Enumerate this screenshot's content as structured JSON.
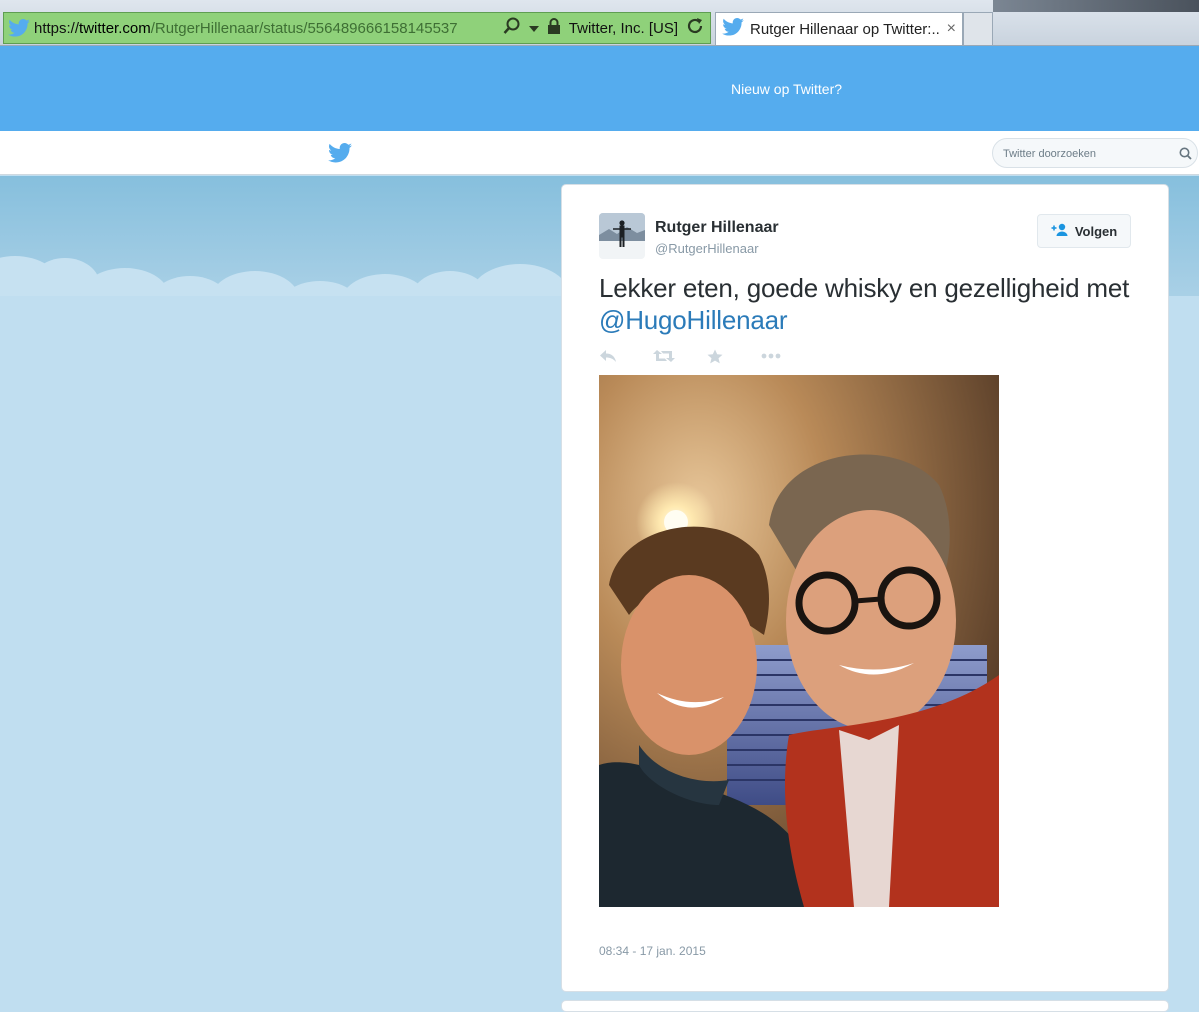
{
  "browser": {
    "url_scheme": "https://",
    "url_domain": "twitter.com",
    "url_path": "/RutgerHillenaar/status/556489666158145537",
    "site_identity": "Twitter, Inc. [US]",
    "tab_title": "Rutger Hillenaar op Twitter:...",
    "tab_close": "×"
  },
  "banner": {
    "text": "Nieuw op Twitter?"
  },
  "topbar": {
    "search_placeholder": "Twitter doorzoeken"
  },
  "tweet": {
    "fullname": "Rutger Hillenaar",
    "username": "@RutgerHillenaar",
    "follow_label": "Volgen",
    "text": "Lekker eten, goede whisky en gezelligheid met ",
    "mention": "@HugoHillenaar",
    "timestamp": "08:34 - 17 jan. 2015",
    "actions": [
      "reply-icon",
      "retweet-icon",
      "favorite-icon",
      "more-icon"
    ]
  },
  "colors": {
    "twitter_blue": "#55acee",
    "link_blue": "#2b7bb9",
    "address_bar_green": "#8fd17a"
  }
}
